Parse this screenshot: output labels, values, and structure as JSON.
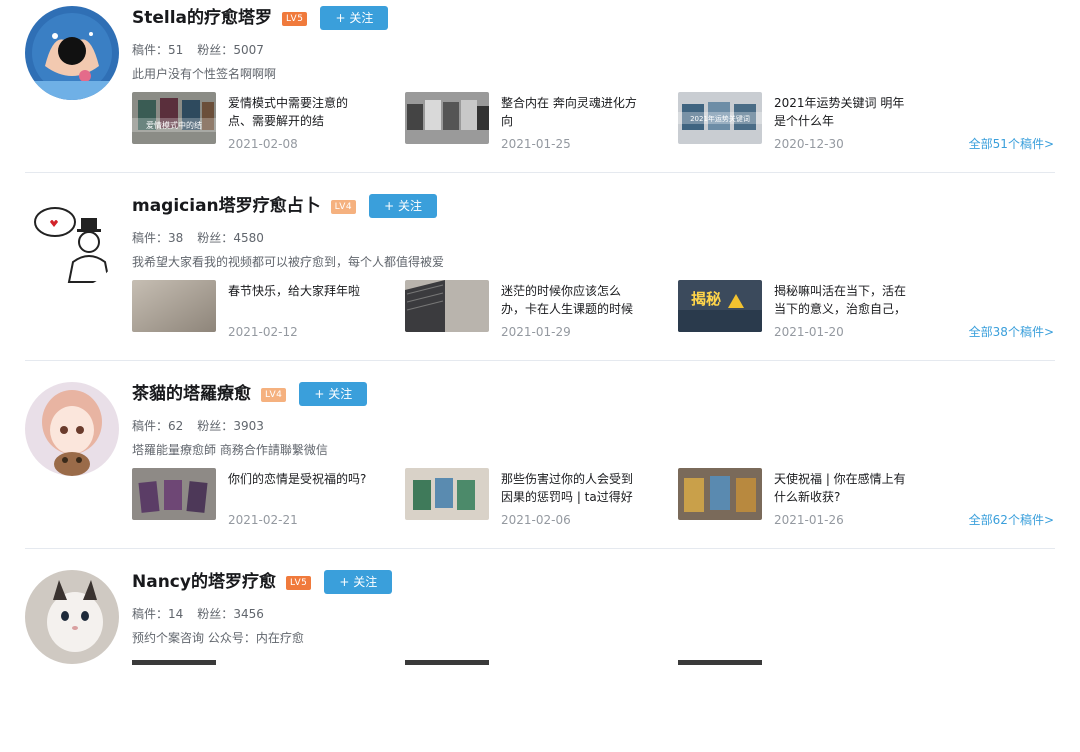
{
  "users": [
    {
      "name": "Stella的疗愈塔罗",
      "level": "LV5",
      "level_color": "#f07a3c",
      "follow_label": "+ 关注",
      "manuscripts_label": "稿件：",
      "manuscripts": "51",
      "fans_label": "粉丝：",
      "fans": "5007",
      "signature": "此用户没有个性签名啊啊啊",
      "videos": [
        {
          "title": "爱情模式中需要注意的点、需要解开的结",
          "date": "2021-02-08",
          "thumb_text": "爱情模式中的结"
        },
        {
          "title": "整合内在 奔向灵魂进化方向",
          "date": "2021-01-25",
          "thumb_text": ""
        },
        {
          "title": "2021年运势关键词 明年是个什么年",
          "date": "2020-12-30",
          "thumb_text": "2021年运势关键词"
        }
      ],
      "more_label": "全部51个稿件>"
    },
    {
      "name": "magician塔罗疗愈占卜",
      "level": "LV4",
      "level_color": "#f5b17f",
      "follow_label": "+ 关注",
      "manuscripts_label": "稿件：",
      "manuscripts": "38",
      "fans_label": "粉丝：",
      "fans": "4580",
      "signature": "我希望大家看我的视频都可以被疗愈到，每个人都值得被爱",
      "videos": [
        {
          "title": "春节快乐，给大家拜年啦",
          "date": "2021-02-12",
          "thumb_text": ""
        },
        {
          "title": "迷茫的时候你应该怎么办，卡在人生课题的时候",
          "date": "2021-01-29",
          "thumb_text": ""
        },
        {
          "title": "揭秘嘛叫活在当下，活在当下的意义，治愈自己，",
          "date": "2021-01-20",
          "thumb_text": "揭秘"
        }
      ],
      "more_label": "全部38个稿件>"
    },
    {
      "name": "茶貓的塔羅療愈",
      "level": "LV4",
      "level_color": "#f5b17f",
      "follow_label": "+ 关注",
      "manuscripts_label": "稿件：",
      "manuscripts": "62",
      "fans_label": "粉丝：",
      "fans": "3903",
      "signature": "塔羅能量療愈師 商務合作請聯繫微信",
      "videos": [
        {
          "title": "你们的恋情是受祝福的吗?",
          "date": "2021-02-21",
          "thumb_text": ""
        },
        {
          "title": "那些伤害过你的人会受到因果的惩罚吗 | ta过得好",
          "date": "2021-02-06",
          "thumb_text": ""
        },
        {
          "title": "天使祝福 | 你在感情上有什么新收获?",
          "date": "2021-01-26",
          "thumb_text": ""
        }
      ],
      "more_label": "全部62个稿件>"
    },
    {
      "name": "Nancy的塔罗疗愈",
      "level": "LV5",
      "level_color": "#f07a3c",
      "follow_label": "+ 关注",
      "manuscripts_label": "稿件：",
      "manuscripts": "14",
      "fans_label": "粉丝：",
      "fans": "3456",
      "signature": "预约个案咨询 公众号：内在疗愈",
      "videos": [],
      "more_label": ""
    }
  ]
}
